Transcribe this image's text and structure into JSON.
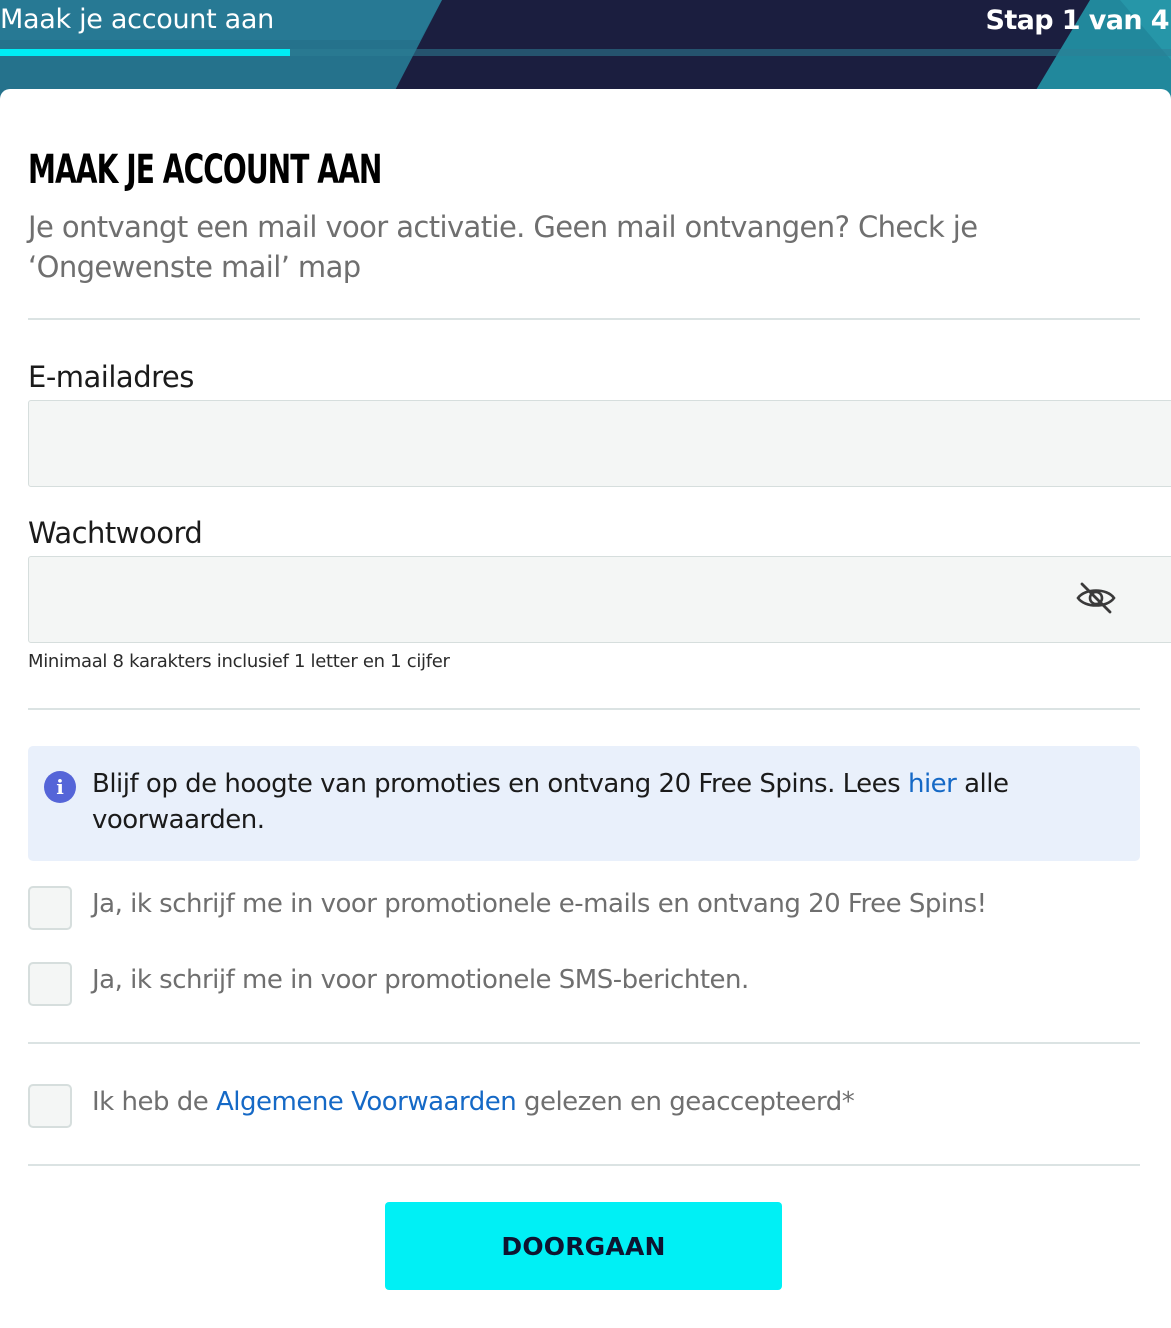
{
  "header": {
    "title": "Maak je account aan",
    "step": "Stap 1 van 4",
    "progress": 0.25
  },
  "main": {
    "title": "MAAK JE ACCOUNT AAN",
    "subtitle": "Je ontvangt een mail voor activatie. Geen mail ontvangen? Check je ‘Ongewenste mail’ map"
  },
  "form": {
    "email_label": "E-mailadres",
    "email_value": "",
    "password_label": "Wachtwoord",
    "password_value": "",
    "password_hint": "Minimaal 8 karakters inclusief 1 letter en 1 cijfer",
    "password_toggle_icon": "eye-slash-icon"
  },
  "info": {
    "icon": "info-icon",
    "text_before": "Blijf op de hoogte van promoties en ontvang 20 Free Spins. Lees ",
    "link": "hier",
    "text_after": " alle voorwaarden."
  },
  "consents": {
    "email_promo": "Ja, ik schrijf me in voor promotionele e-mails en ontvang 20 Free Spins!",
    "sms_promo": "Ja, ik schrijf me in voor promotionele SMS-berichten.",
    "terms_before": "Ik heb de ",
    "terms_link": "Algemene Voorwaarden",
    "terms_after": " gelezen en geaccepteerd*"
  },
  "submit_label": "DOORGAAN",
  "colors": {
    "header_bg": "#1b1e3f",
    "accent": "#00f0f5",
    "link": "#1569c6",
    "info_bg": "#e9f0fb"
  }
}
